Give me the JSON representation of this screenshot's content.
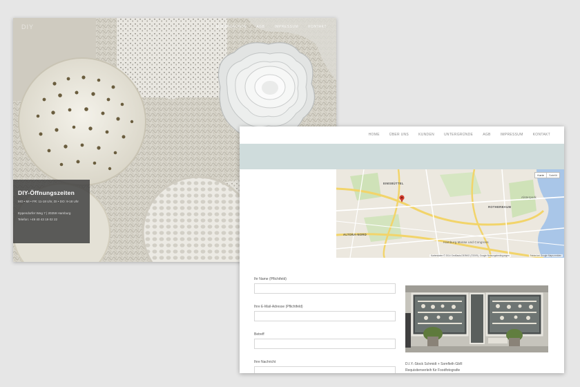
{
  "hero": {
    "logo": "DIY",
    "nav": [
      "Untergründe",
      "AGB",
      "Impressum",
      "Kontakt"
    ],
    "hours": {
      "title": "DIY-Öffnungszeiten",
      "days": "MO • MI • FR: 11-18 Uhr, DI • DO: 9-18 Uhr",
      "address": "Eppendorfer Weg 7 | 20259 Hamburg",
      "phone": "Telefon: +49 40 43 19 02 22"
    }
  },
  "contact": {
    "nav": [
      "Home",
      "Über uns",
      "Kunden",
      "Untergründe",
      "AGB",
      "Impressum",
      "Kontakt"
    ],
    "map": {
      "buttons": [
        "Karte",
        "Satellit"
      ],
      "places": [
        "EIMSBÜTTEL",
        "ROTHERBAUM",
        "ALTONA-NORD",
        "Hamburg Messe und Congress",
        "Alsterpark"
      ],
      "attribution": "Kartendaten © 2014 GeoBasis-DE/BKG (©2009), Google",
      "terms": "Nutzungsbedingungen",
      "report": "Fehler bei Google Maps melden"
    },
    "form": {
      "name_label": "Ihr Name (Pflichtfeld)",
      "email_label": "Ihre E-Mail-Adresse (Pflichtfeld)",
      "subject_label": "Betreff",
      "message_label": "Ihre Nachricht"
    },
    "caption": {
      "line1": "D.I.Y.-Stock  Schmidt + Somfleth GbR",
      "line2": "Requisitenverleih für Foodfotografie"
    }
  }
}
